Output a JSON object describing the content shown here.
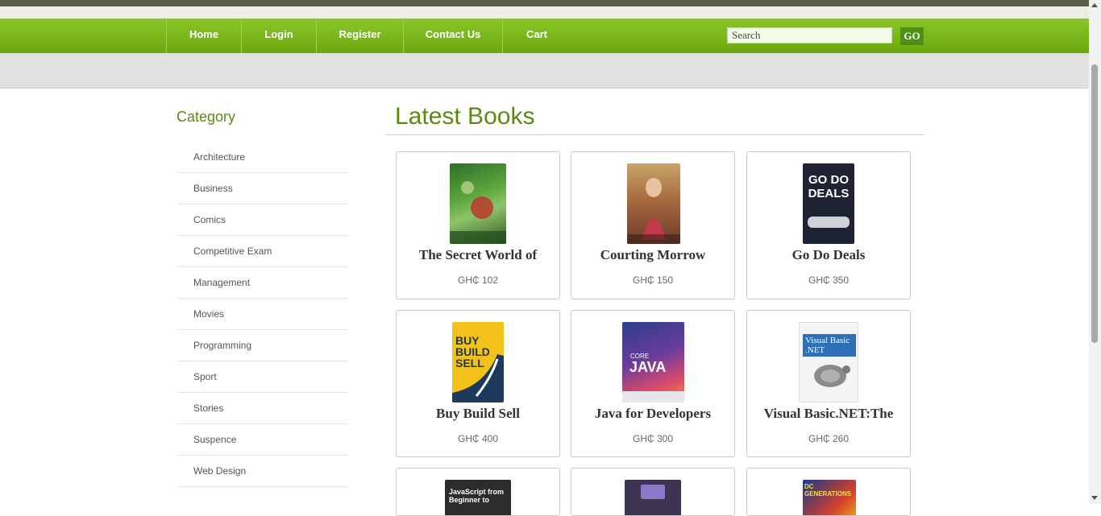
{
  "nav": {
    "items": [
      "Home",
      "Login",
      "Register",
      "Contact Us",
      "Cart"
    ],
    "search_placeholder": "Search",
    "go_label": "GO"
  },
  "sidebar": {
    "title": "Category",
    "items": [
      "Architecture",
      "Business",
      "Comics",
      "Competitive Exam",
      "Management",
      "Movies",
      "Programming",
      "Sport",
      "Stories",
      "Suspence",
      "Web Design"
    ]
  },
  "main": {
    "title": "Latest Books",
    "books": [
      {
        "title": "The Secret World of",
        "price": "GH₵ 102"
      },
      {
        "title": "Courting Morrow",
        "price": "GH₵ 150"
      },
      {
        "title": "Go Do Deals",
        "price": "GH₵ 350"
      },
      {
        "title": "Buy Build Sell",
        "price": "GH₵ 400"
      },
      {
        "title": "Java for Developers",
        "price": "GH₵ 300"
      },
      {
        "title": "Visual Basic.NET:The",
        "price": "GH₵ 260"
      }
    ],
    "cover_text": {
      "go_do_deals": "GO DO DEALS",
      "buy_build_sell": "BUY BUILD SELL",
      "core": "CORE",
      "java": "JAVA",
      "visual_basic": "Visual Basic .NET",
      "javascript": "JavaScript from Beginner to",
      "dc": "DC GENERATIONS"
    }
  },
  "colors": {
    "nav_green": "#7ab81c",
    "title_green": "#5b8a13",
    "go_button": "#4e8f1a"
  }
}
